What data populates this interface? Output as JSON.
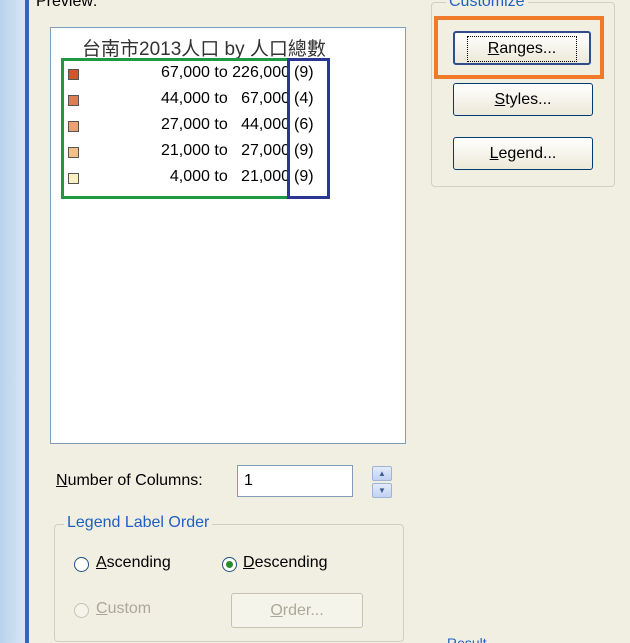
{
  "preview": {
    "label": "Preview:",
    "title": "台南市2013人口 by 人口總數",
    "legend": [
      {
        "range": "67,000 to 226,000",
        "count": "(9)",
        "color": "#d4542c"
      },
      {
        "range": "44,000 to   67,000",
        "count": "(4)",
        "color": "#e17c4c"
      },
      {
        "range": "27,000 to   44,000",
        "count": "(6)",
        "color": "#eba275"
      },
      {
        "range": "21,000 to   27,000",
        "count": "(9)",
        "color": "#f3c089"
      },
      {
        "range": "4,000 to   21,000",
        "count": "(9)",
        "color": "#fbf0c4"
      }
    ]
  },
  "customize": {
    "title": "Customize",
    "ranges_label": "Ranges...",
    "ranges_accel": "R",
    "styles_label": "Styles...",
    "styles_accel": "S",
    "legend_label": "Legend...",
    "legend_accel": "L"
  },
  "columns": {
    "label": "Number of Columns:",
    "accel": "N",
    "value": "1"
  },
  "order": {
    "title": "Legend Label Order",
    "ascending": "Ascending",
    "ascending_accel": "A",
    "descending": "Descending",
    "descending_accel": "D",
    "selected": "Descending",
    "custom": "Custom",
    "custom_accel": "C",
    "order_button": "Order...",
    "order_accel": "O"
  },
  "highlights": {
    "green": "#1a9a43",
    "blue": "#2b3694",
    "orange": "#f07a28"
  },
  "bottom_stub": "Result"
}
